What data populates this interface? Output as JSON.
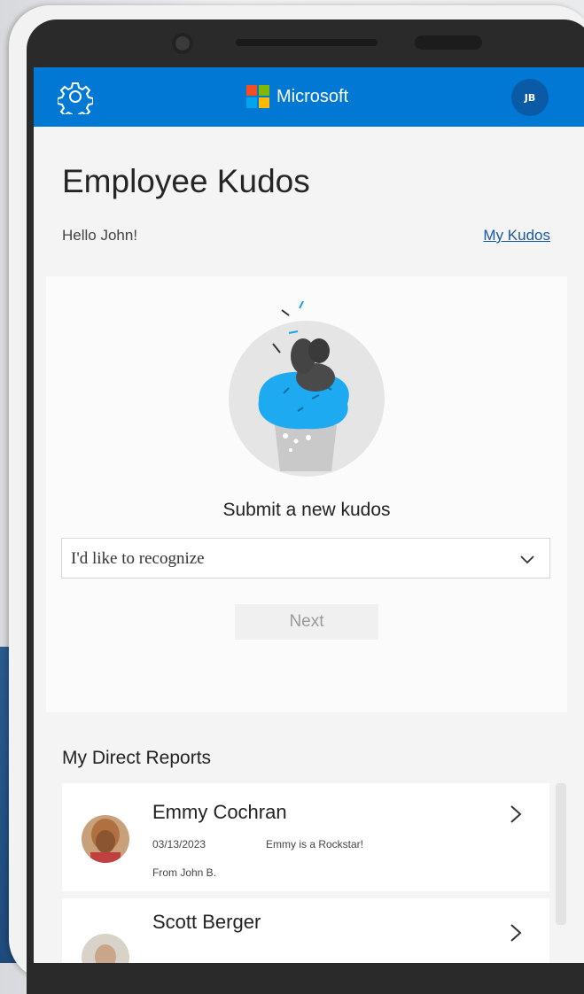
{
  "header": {
    "brand": "Microsoft",
    "avatar_initials": "JB",
    "settings_icon": "gear-icon",
    "color_primary": "#0078d4"
  },
  "page": {
    "title": "Employee Kudos",
    "greeting": "Hello John!",
    "my_kudos_link": "My Kudos"
  },
  "submit": {
    "title": "Submit a new kudos",
    "dropdown_value": "I'd like to recognize",
    "next_label": "Next"
  },
  "reports": {
    "title": "My Direct Reports",
    "items": [
      {
        "name": "Emmy Cochran",
        "date": "03/13/2023",
        "message": "Emmy is a Rockstar!",
        "from": "From John B."
      },
      {
        "name": "Scott Berger"
      }
    ]
  }
}
